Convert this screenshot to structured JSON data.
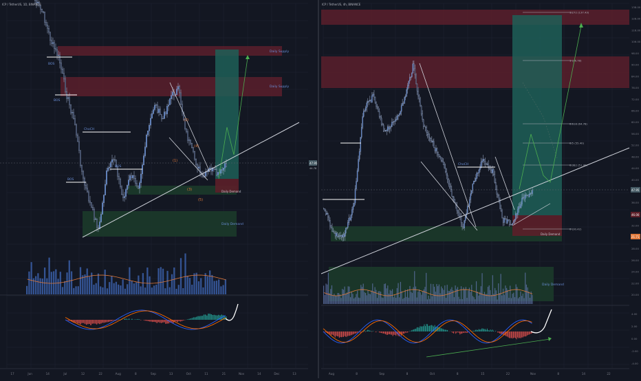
{
  "colors": {
    "background": "#131722",
    "grid": "#1f2433",
    "axis_text": "#787b86",
    "candle": "#4a78c8",
    "candle_outline": "#a9b9d8",
    "supply_zone": "#5a1f2b",
    "demand_zone": "#1c3a2a",
    "long_target": "#1f5f57",
    "long_stop": "#5c1f29",
    "white_line": "#d1d4dc",
    "volume_bar": "#3b5fa8",
    "volume_ma": "#e0793b",
    "macd_line": "#2962ff",
    "signal_line": "#ff6d00",
    "hist_pos": "#26a69a",
    "hist_neg": "#ef5350",
    "projection": "#4caf50",
    "price_tag": "#455a64",
    "price_tag_red": "#e0793b",
    "price_tag_green": "#26a69a"
  },
  "left": {
    "title": "ICP / TetherUS, 1D, BINANCE",
    "price_tag": "47.95",
    "price_tag2": "44.78",
    "zones": {
      "daily_supply_1": "Daily Supply",
      "daily_supply_2": "Daily Supply",
      "daily_demand_small": "Daily Demand",
      "daily_demand": "Daily Demand"
    },
    "labels": {
      "bos1": "BOS",
      "bos2": "BOS",
      "bos3": "BOS",
      "choch": "ChoCH",
      "bos4": "BOS",
      "wave_1": "(1)",
      "wave_2": "(2)",
      "wave_3": "(3)",
      "wave_4": "(4)",
      "wave_5": "(5)"
    },
    "x_ticks": [
      "17",
      "Jun",
      "14",
      "Jul",
      "12",
      "22",
      "Aug",
      "8",
      "Sep",
      "13",
      "Oct",
      "11",
      "21",
      "Nov",
      "14",
      "Dec",
      "13"
    ]
  },
  "right": {
    "title": "ICP / TetherUS, 4h, BINANCE",
    "price_scale": [
      "138.00",
      "128.00",
      "116.00",
      "106.00",
      "98.00",
      "90.00",
      "84.00",
      "78.00",
      "72.00",
      "66.00",
      "60.00",
      "56.00",
      "52.00",
      "48.00",
      "44.00",
      "40.00",
      "38.00",
      "36.00",
      "34.00",
      "32.00",
      "30.00",
      "28.00",
      "26.00",
      "24.00",
      "22.00",
      "20.00"
    ],
    "price_tags": [
      "47.95",
      "46.00",
      "21.71"
    ],
    "levels": {
      "l1": "1.272 (137.43)",
      "l2": "1 (96.78)",
      "l3": "0.618 (64.78)",
      "l4": "0.5 (55.40)",
      "l5": "0.382 (51.49)",
      "l6": "0 (30.42)"
    },
    "zone_labels": {
      "demand": "Daily Demand",
      "demand2": "Daily Demand"
    },
    "choch": "ChoCH",
    "macd_scale": [
      "4.00",
      "2.00",
      "0.00",
      "-2.00",
      "-4.00"
    ],
    "x_ticks": [
      "Aug",
      "8",
      "Sep",
      "8",
      "Oct",
      "8",
      "15",
      "22",
      "Nov",
      "8",
      "14",
      "22"
    ]
  },
  "chart_data": [
    {
      "type": "candlestick",
      "title": "ICP / TetherUS, 1D, BINANCE",
      "x": [
        "17",
        "Jun",
        "14",
        "Jul",
        "12",
        "22",
        "Aug",
        "8",
        "Sep",
        "13",
        "Oct",
        "11",
        "21",
        "Nov",
        "14",
        "Dec",
        "13"
      ],
      "series": [
        {
          "name": "price",
          "values": [
            160,
            140,
            120,
            90,
            68,
            55,
            38,
            33,
            30,
            28,
            36,
            42,
            45,
            58,
            55,
            48,
            42,
            40,
            48,
            52,
            50,
            44,
            40,
            45,
            47
          ]
        }
      ],
      "annotations": [
        "Daily Supply",
        "Daily Supply",
        "Daily Demand",
        "Daily Demand",
        "BOS",
        "BOS",
        "BOS",
        "ChoCH",
        "BOS",
        "(1)",
        "(2)",
        "(3)",
        "(4)",
        "(5)"
      ],
      "grid": true,
      "legend": "none"
    },
    {
      "type": "candlestick",
      "title": "ICP / TetherUS, 4h, BINANCE",
      "x": [
        "Aug",
        "8",
        "Sep",
        "8",
        "Oct",
        "8",
        "15",
        "22",
        "Nov",
        "8",
        "14",
        "22"
      ],
      "series": [
        {
          "name": "price",
          "values": [
            34,
            32,
            30,
            56,
            66,
            62,
            58,
            55,
            70,
            78,
            60,
            54,
            48,
            42,
            35,
            45,
            50,
            40,
            34,
            40,
            44,
            47
          ]
        }
      ],
      "ylim": [
        20,
        138
      ],
      "annotations": [
        "1.272 (137.43)",
        "1 (96.78)",
        "0.618 (64.78)",
        "0.5 (55.40)",
        "0.382 (51.49)",
        "0 (30.42)",
        "Daily Demand",
        "ChoCH"
      ],
      "grid": true,
      "legend": "none"
    }
  ]
}
